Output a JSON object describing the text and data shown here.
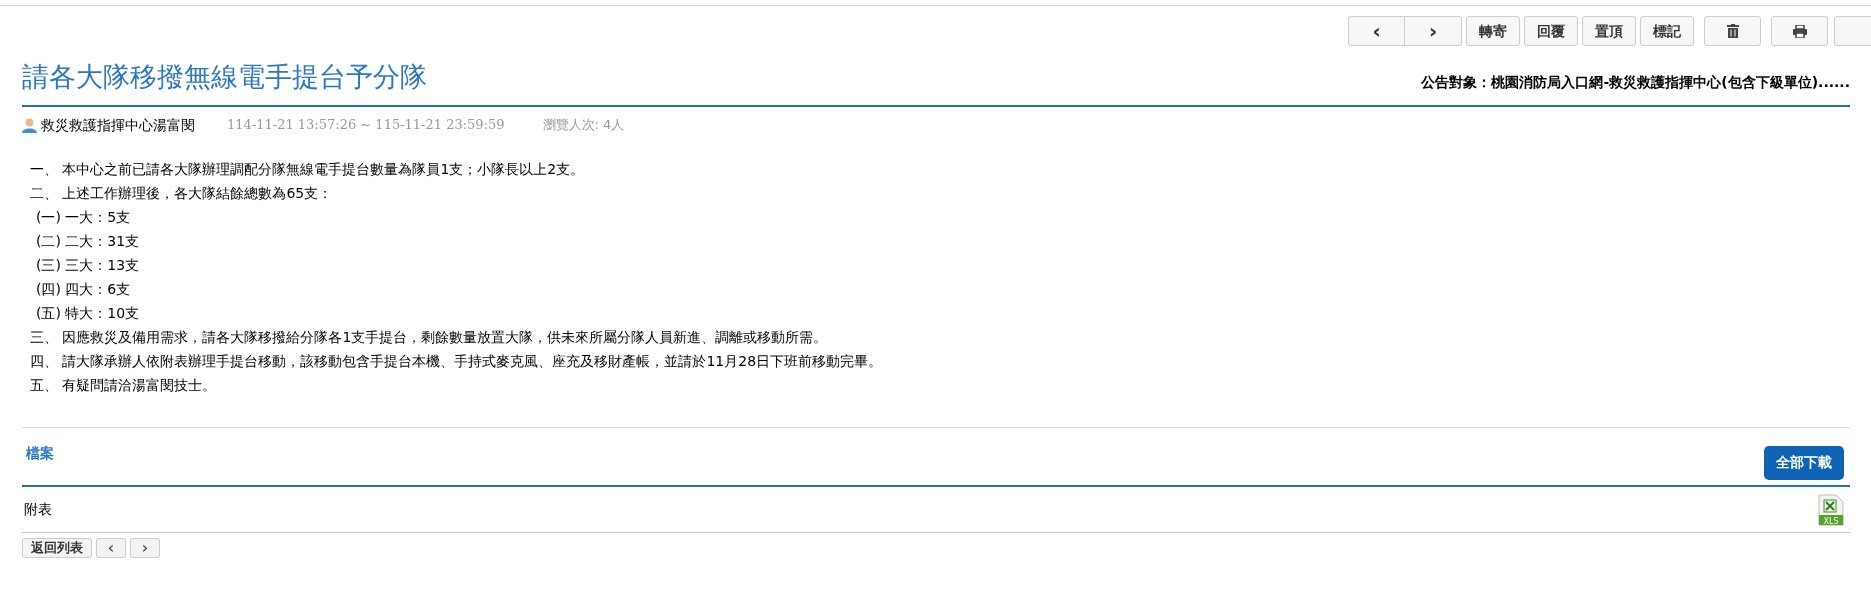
{
  "toolbar": {
    "nav": [
      "‹",
      "›"
    ],
    "buttons": [
      "轉寄",
      "回覆",
      "置頂",
      "標記"
    ],
    "icon_buttons": [
      {
        "kind": "delete"
      },
      {
        "kind": "print"
      }
    ]
  },
  "title": "請各大隊移撥無線電手提台予分隊",
  "audience": "公告對象：桃園消防局入口網-救災救護指揮中心(包含下級單位)......",
  "meta": {
    "author": "救災救護指揮中心湯富閔",
    "period": "114-11-21 13:57:26 ~ 115-11-21 23:59:59",
    "views": "瀏覽人次: 4人"
  },
  "body": [
    {
      "text": "一、 本中心之前已請各大隊辦理調配分隊無線電手提台數量為隊員1支；小隊長以上2支。",
      "kind": "item"
    },
    {
      "text": "二、 上述工作辦理後，各大隊結餘總數為65支：",
      "kind": "item"
    },
    {
      "text": "(一) 一大：5支",
      "kind": "sub"
    },
    {
      "text": "(二) 二大：31支",
      "kind": "sub"
    },
    {
      "text": "(三) 三大：13支",
      "kind": "sub"
    },
    {
      "text": "(四) 四大：6支",
      "kind": "sub"
    },
    {
      "text": "(五) 特大：10支",
      "kind": "sub"
    },
    {
      "text": "三、 因應救災及備用需求，請各大隊移撥給分隊各1支手提台，剩餘數量放置大隊，供未來所屬分隊人員新進、調離或移動所需。",
      "kind": "item"
    },
    {
      "text": "四、 請大隊承辦人依附表辦理手提台移動，該移動包含手提台本機、手持式麥克風、座充及移財產帳，並請於11月28日下班前移動完畢。",
      "kind": "item"
    },
    {
      "text": "五、 有疑問請洽湯富閔技士。",
      "kind": "item"
    }
  ],
  "files": {
    "heading": "檔案",
    "download_all": "全部下載",
    "items": [
      {
        "name": "附表",
        "type": "XLS"
      }
    ]
  },
  "footer": {
    "back": "返回列表",
    "nav": [
      "‹",
      "›"
    ]
  }
}
